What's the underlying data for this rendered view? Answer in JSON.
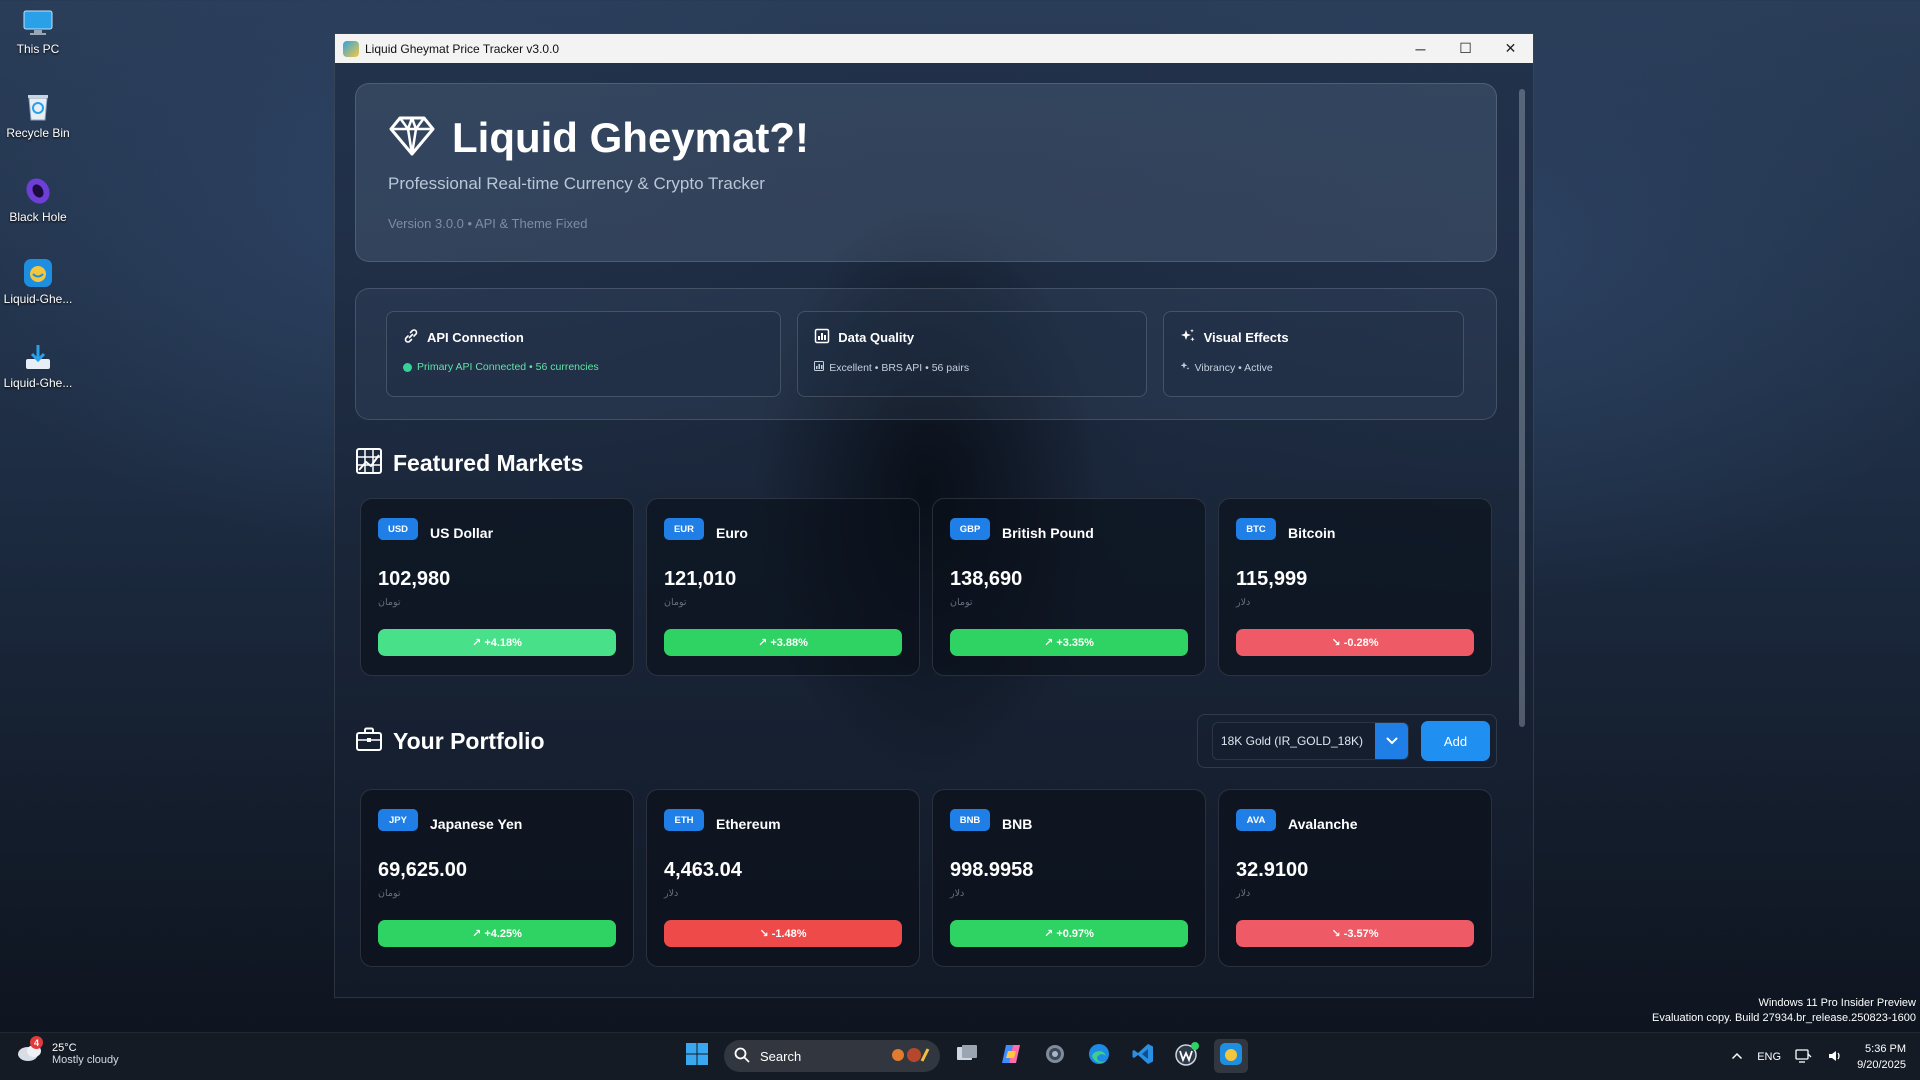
{
  "desktop": {
    "icons": [
      {
        "label": "This PC"
      },
      {
        "label": "Recycle Bin"
      },
      {
        "label": "Black Hole"
      },
      {
        "label": "Liquid-Ghe..."
      },
      {
        "label": "Liquid-Ghe..."
      }
    ]
  },
  "window": {
    "title": "Liquid Gheymat Price Tracker v3.0.0",
    "minimize": "─",
    "maximize": "☐",
    "close": "✕"
  },
  "hero": {
    "title": "Liquid Gheymat?!",
    "subtitle": "Professional Real-time Currency & Crypto Tracker",
    "version": "Version 3.0.0 • API & Theme Fixed"
  },
  "status": {
    "api": {
      "title": "API Connection",
      "detail": "Primary API Connected • 56 currencies",
      "icon": "link-icon"
    },
    "quality": {
      "title": "Data Quality",
      "detail": "Excellent • BRS API • 56 pairs",
      "icon": "chart-icon"
    },
    "effects": {
      "title": "Visual Effects",
      "detail": "Vibrancy • Active",
      "icon": "sparkles-icon"
    }
  },
  "featured": {
    "title": "Featured Markets",
    "cards": [
      {
        "code": "USD",
        "name": "US Dollar",
        "price": "102,980",
        "unit": "تومان",
        "change": "↗ +4.18%",
        "direction": "up"
      },
      {
        "code": "EUR",
        "name": "Euro",
        "price": "121,010",
        "unit": "تومان",
        "change": "↗ +3.88%",
        "direction": "up"
      },
      {
        "code": "GBP",
        "name": "British Pound",
        "price": "138,690",
        "unit": "تومان",
        "change": "↗ +3.35%",
        "direction": "up"
      },
      {
        "code": "BTC",
        "name": "Bitcoin",
        "price": "115,999",
        "unit": "دلار",
        "change": "↘ -0.28%",
        "direction": "down"
      }
    ]
  },
  "portfolio": {
    "title": "Your Portfolio",
    "select_value": "18K Gold (IR_GOLD_18K)",
    "add_label": "Add",
    "cards": [
      {
        "code": "JPY",
        "name": "Japanese Yen",
        "price": "69,625.00",
        "unit": "تومان",
        "change": "↗ +4.25%",
        "direction": "up"
      },
      {
        "code": "ETH",
        "name": "Ethereum",
        "price": "4,463.04",
        "unit": "دلار",
        "change": "↘ -1.48%",
        "direction": "down"
      },
      {
        "code": "BNB",
        "name": "BNB",
        "price": "998.9958",
        "unit": "دلار",
        "change": "↗ +0.97%",
        "direction": "up"
      },
      {
        "code": "AVA",
        "name": "Avalanche",
        "price": "32.9100",
        "unit": "دلار",
        "change": "↘ -3.57%",
        "direction": "down"
      }
    ]
  },
  "taskbar": {
    "weather_badge": "4",
    "temperature": "25°C",
    "condition": "Mostly cloudy",
    "search_label": "Search",
    "language": "ENG",
    "time": "5:36 PM",
    "date": "9/20/2025"
  },
  "watermark": {
    "line1": "Windows 11 Pro Insider Preview",
    "line2": "Evaluation copy. Build 27934.br_release.250823-1600"
  },
  "colors": {
    "accent": "#1f7fe6",
    "up": "#2fd363",
    "down": "#ef4a4a"
  }
}
